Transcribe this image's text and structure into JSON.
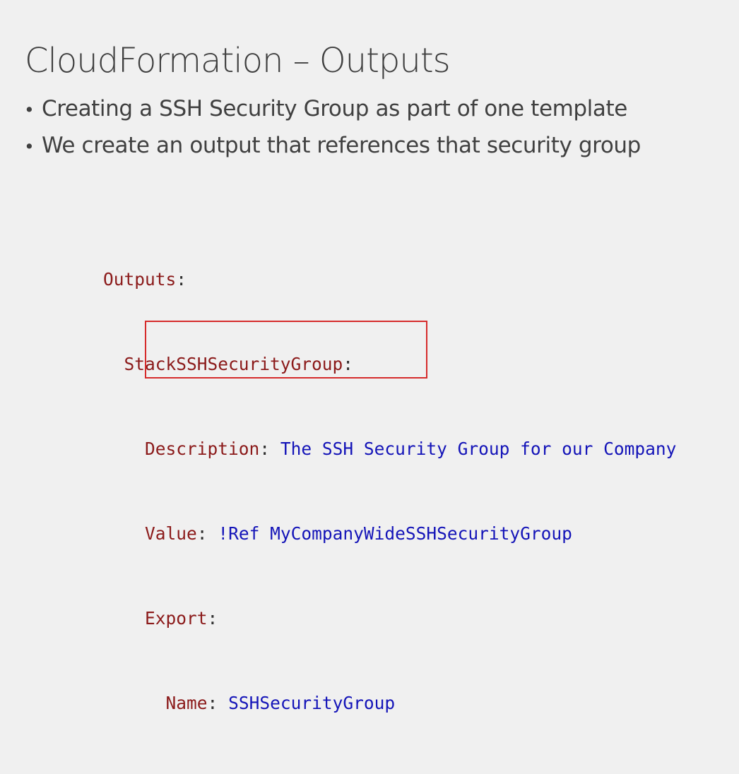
{
  "slide": {
    "title": "CloudFormation – Outputs",
    "bullets": [
      "Creating a SSH Security Group as part of one template",
      "We create an output that references that security group"
    ]
  },
  "code": {
    "outputs_key": "Outputs",
    "logical_id": "StackSSHSecurityGroup",
    "description_key": "Description",
    "description_value": "The SSH Security Group for our Company",
    "value_key": "Value",
    "value_value": "!Ref MyCompanyWideSSHSecurityGroup",
    "export_key": "Export",
    "name_key": "Name",
    "name_value": "SSHSecurityGroup",
    "colon": ":"
  },
  "colors": {
    "key": "#8b1a1a",
    "value": "#1414b8",
    "highlight_box": "#d62b2b",
    "background": "#f0f0f0",
    "text": "#404040"
  }
}
